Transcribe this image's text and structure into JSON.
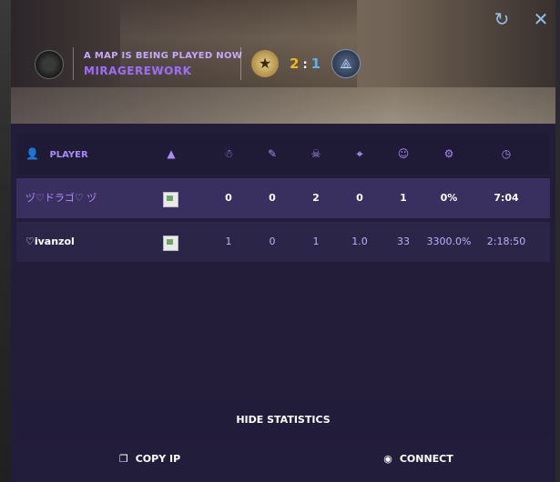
{
  "header": {
    "subtitle": "A MAP IS BEING PLAYED NOW",
    "map_name": "MIRAGEREWORK",
    "score_t": "2",
    "score_sep": ":",
    "score_ct": "1",
    "refresh_icon": "↻",
    "close_icon": "✕"
  },
  "table": {
    "columns": [
      {
        "label": "PLAYER",
        "icon": "👤",
        "name": "player-icon"
      },
      {
        "label": "",
        "icon": "▲",
        "name": "rank-icon"
      },
      {
        "label": "",
        "icon": "☃",
        "name": "kills-icon"
      },
      {
        "label": "",
        "icon": "✎",
        "name": "assists-icon"
      },
      {
        "label": "",
        "icon": "☠",
        "name": "deaths-icon"
      },
      {
        "label": "",
        "icon": "⌖",
        "name": "crosshair-icon"
      },
      {
        "label": "",
        "icon": "☺",
        "name": "headshot-icon"
      },
      {
        "label": "",
        "icon": "⚙",
        "name": "percent-icon"
      },
      {
        "label": "",
        "icon": "◷",
        "name": "clock-icon"
      }
    ],
    "rows": [
      {
        "player": "ヅ♡ドラゴ♡ ヅ",
        "c1": "0",
        "c2": "0",
        "c3": "2",
        "c4": "0",
        "c5": "1",
        "c6": "0%",
        "c7": "7:04"
      },
      {
        "player": "♡ivanzol",
        "c1": "1",
        "c2": "0",
        "c3": "1",
        "c4": "1.0",
        "c5": "33",
        "c6": "3300.0%",
        "c7": "2:18:50"
      }
    ]
  },
  "buttons": {
    "hide": "HIDE STATISTICS",
    "copy_ip": "COPY IP",
    "connect": "CONNECT"
  },
  "colors": {
    "accent": "#9f6cff",
    "score_t": "#f2b71a",
    "score_ct": "#5fb3f0"
  }
}
